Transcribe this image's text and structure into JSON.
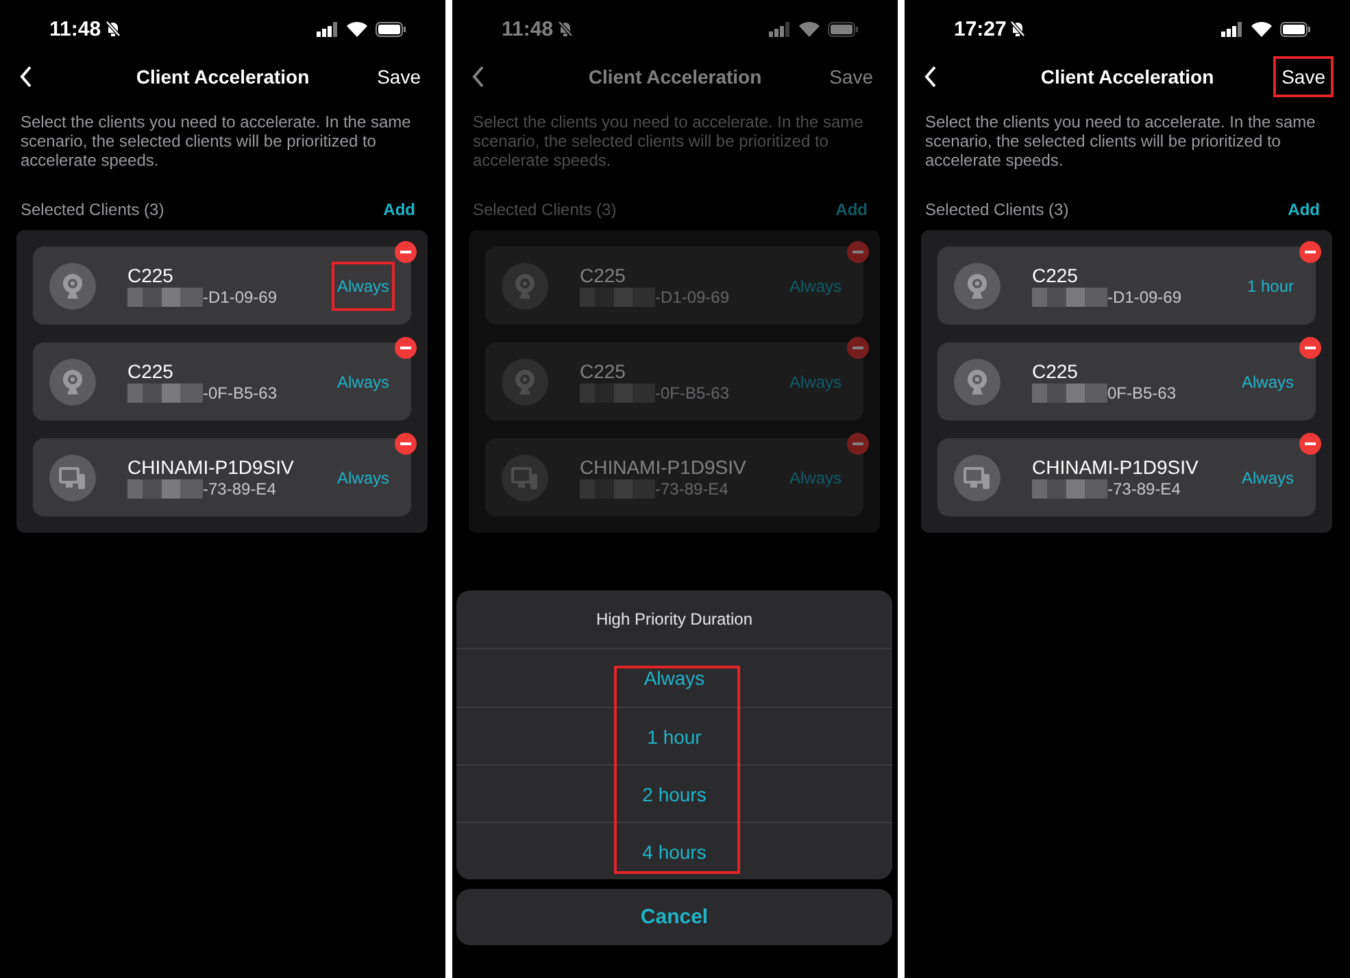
{
  "screens": [
    {
      "status_bar": {
        "time": "11:48"
      },
      "nav": {
        "title": "Client Acceleration",
        "save": "Save",
        "save_highlighted": false
      },
      "dimmed": false,
      "description": "Select the clients you need to accelerate. In the same scenario, the selected clients will be prioritized to accelerate speeds.",
      "section": {
        "label": "Selected Clients (3)",
        "action": "Add"
      },
      "clients": [
        {
          "kind": "camera",
          "name": "C225",
          "mac": "-D1-09-69",
          "duration": "Always",
          "highlighted": true
        },
        {
          "kind": "camera",
          "name": "C225",
          "mac": "-0F-B5-63",
          "duration": "Always",
          "highlighted": false
        },
        {
          "kind": "computer",
          "name": "CHINAMI-P1D9SIV",
          "mac": "-73-89-E4",
          "duration": "Always",
          "highlighted": false
        }
      ]
    },
    {
      "status_bar": {
        "time": "11:48"
      },
      "nav": {
        "title": "Client Acceleration",
        "save": "Save",
        "save_highlighted": false
      },
      "dimmed": true,
      "description": "Select the clients you need to accelerate. In the same scenario, the selected clients will be prioritized to accelerate speeds.",
      "section": {
        "label": "Selected Clients (3)",
        "action": "Add"
      },
      "clients": [
        {
          "kind": "camera",
          "name": "C225",
          "mac": "-D1-09-69",
          "duration": "Always",
          "highlighted": false
        },
        {
          "kind": "camera",
          "name": "C225",
          "mac": "-0F-B5-63",
          "duration": "Always",
          "highlighted": false
        },
        {
          "kind": "computer",
          "name": "CHINAMI-P1D9SIV",
          "mac": "-73-89-E4",
          "duration": "Always",
          "highlighted": false
        }
      ],
      "sheet": {
        "title": "High Priority Duration",
        "options": [
          "Always",
          "1 hour",
          "2 hours",
          "4 hours"
        ],
        "options_highlighted": true,
        "cancel": "Cancel"
      }
    },
    {
      "status_bar": {
        "time": "17:27"
      },
      "nav": {
        "title": "Client Acceleration",
        "save": "Save",
        "save_highlighted": true
      },
      "dimmed": false,
      "description": "Select the clients you need to accelerate. In the same scenario, the selected clients will be prioritized to accelerate speeds.",
      "section": {
        "label": "Selected Clients (3)",
        "action": "Add"
      },
      "clients": [
        {
          "kind": "camera",
          "name": "C225",
          "mac": "-D1-09-69",
          "duration": "1 hour",
          "highlighted": false
        },
        {
          "kind": "camera",
          "name": "C225",
          "mac": "0F-B5-63",
          "duration": "Always",
          "highlighted": false
        },
        {
          "kind": "computer",
          "name": "CHINAMI-P1D9SIV",
          "mac": "-73-89-E4",
          "duration": "Always",
          "highlighted": false
        }
      ]
    }
  ]
}
